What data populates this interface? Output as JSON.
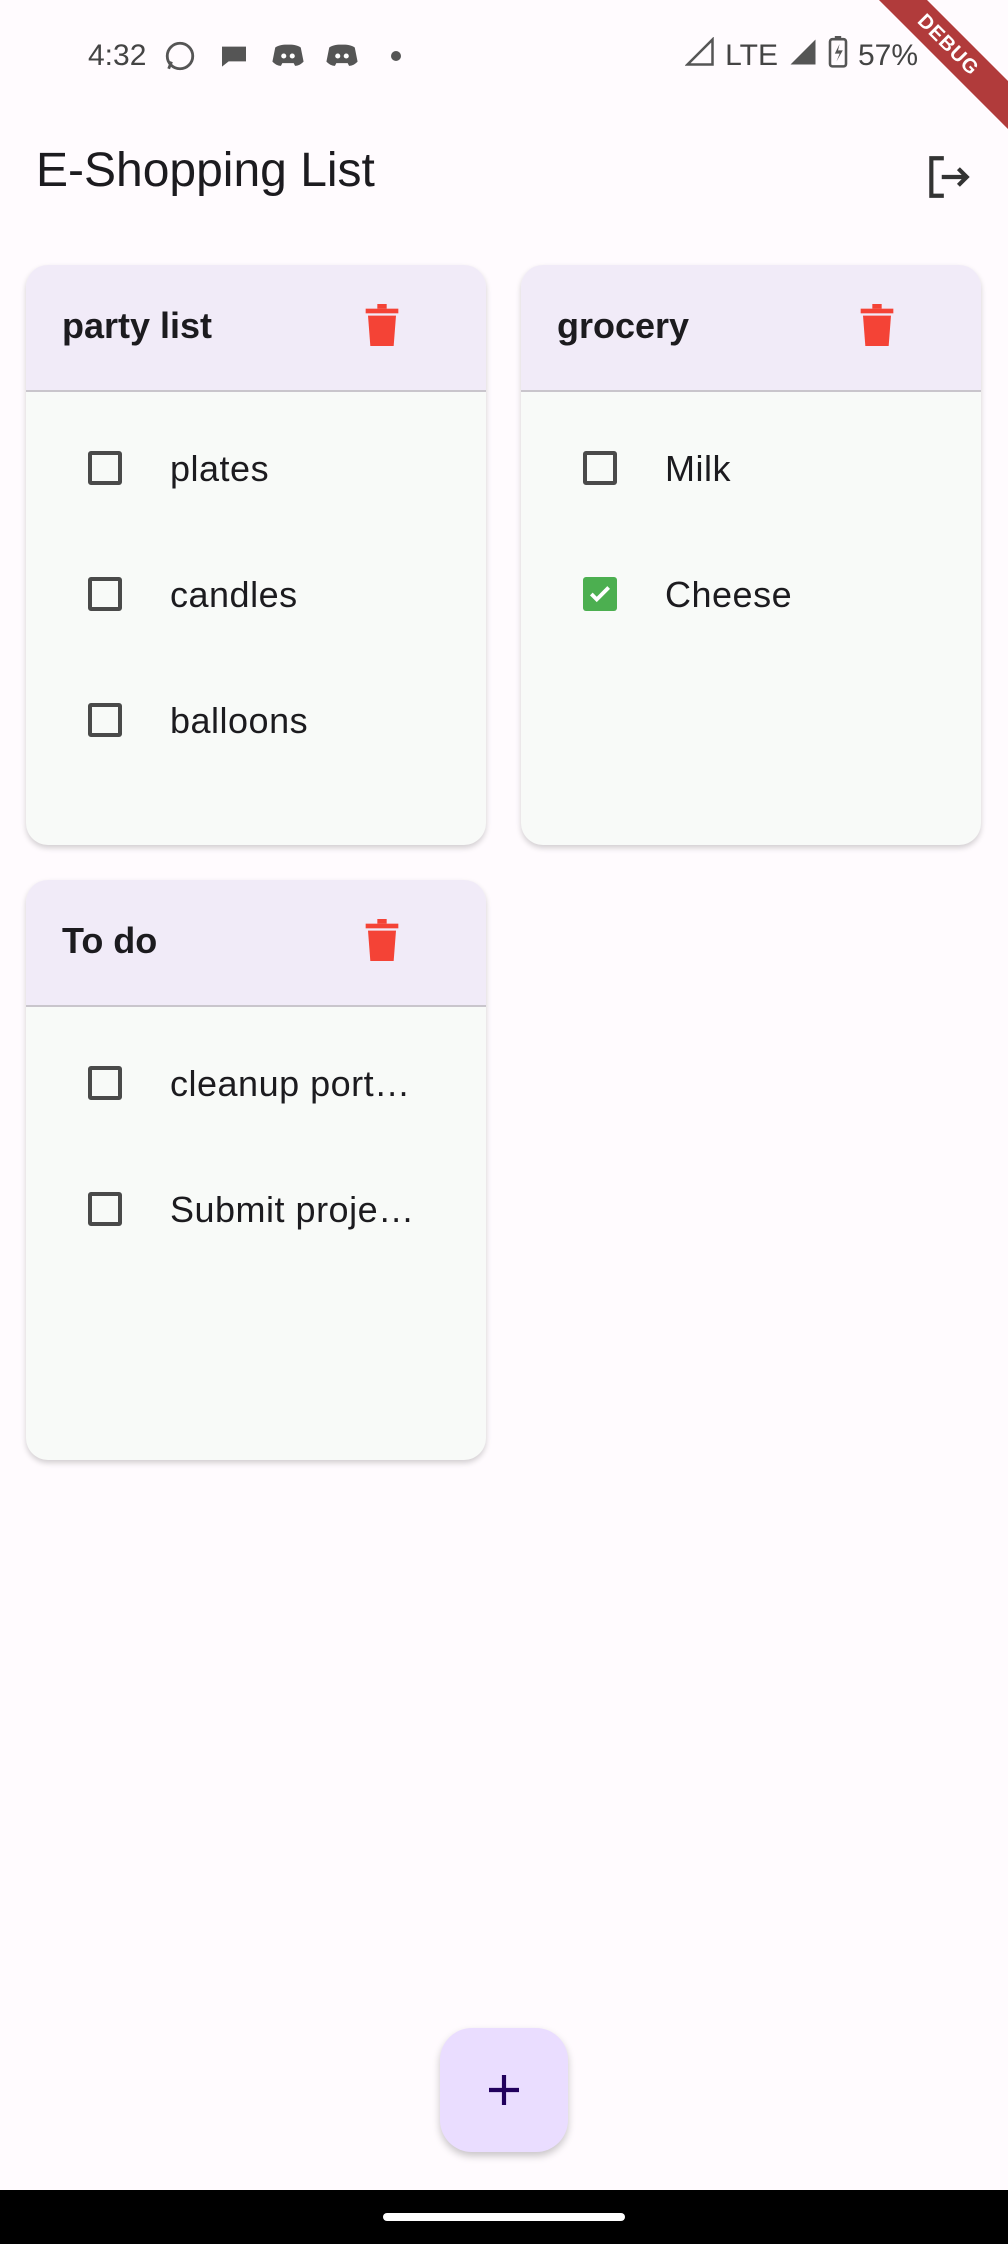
{
  "status_bar": {
    "time": "4:32",
    "network": "LTE",
    "battery": "57%",
    "debug_label": "DEBUG"
  },
  "app_bar": {
    "title": "E-Shopping List",
    "logout_icon": "logout-icon"
  },
  "lists": [
    {
      "title": "party list",
      "items": [
        {
          "label": "plates",
          "checked": false
        },
        {
          "label": "candles",
          "checked": false
        },
        {
          "label": "balloons",
          "checked": false
        }
      ]
    },
    {
      "title": "grocery",
      "items": [
        {
          "label": "Milk",
          "checked": false
        },
        {
          "label": "Cheese",
          "checked": true
        }
      ]
    },
    {
      "title": "To do",
      "items": [
        {
          "label": "cleanup port…",
          "checked": false
        },
        {
          "label": "Submit proje…",
          "checked": false
        }
      ]
    }
  ],
  "fab": {
    "icon": "plus-icon"
  },
  "colors": {
    "accent": "#eaddff",
    "card_header": "#f1ebf8",
    "delete": "#f44336",
    "checked": "#4caf50"
  }
}
